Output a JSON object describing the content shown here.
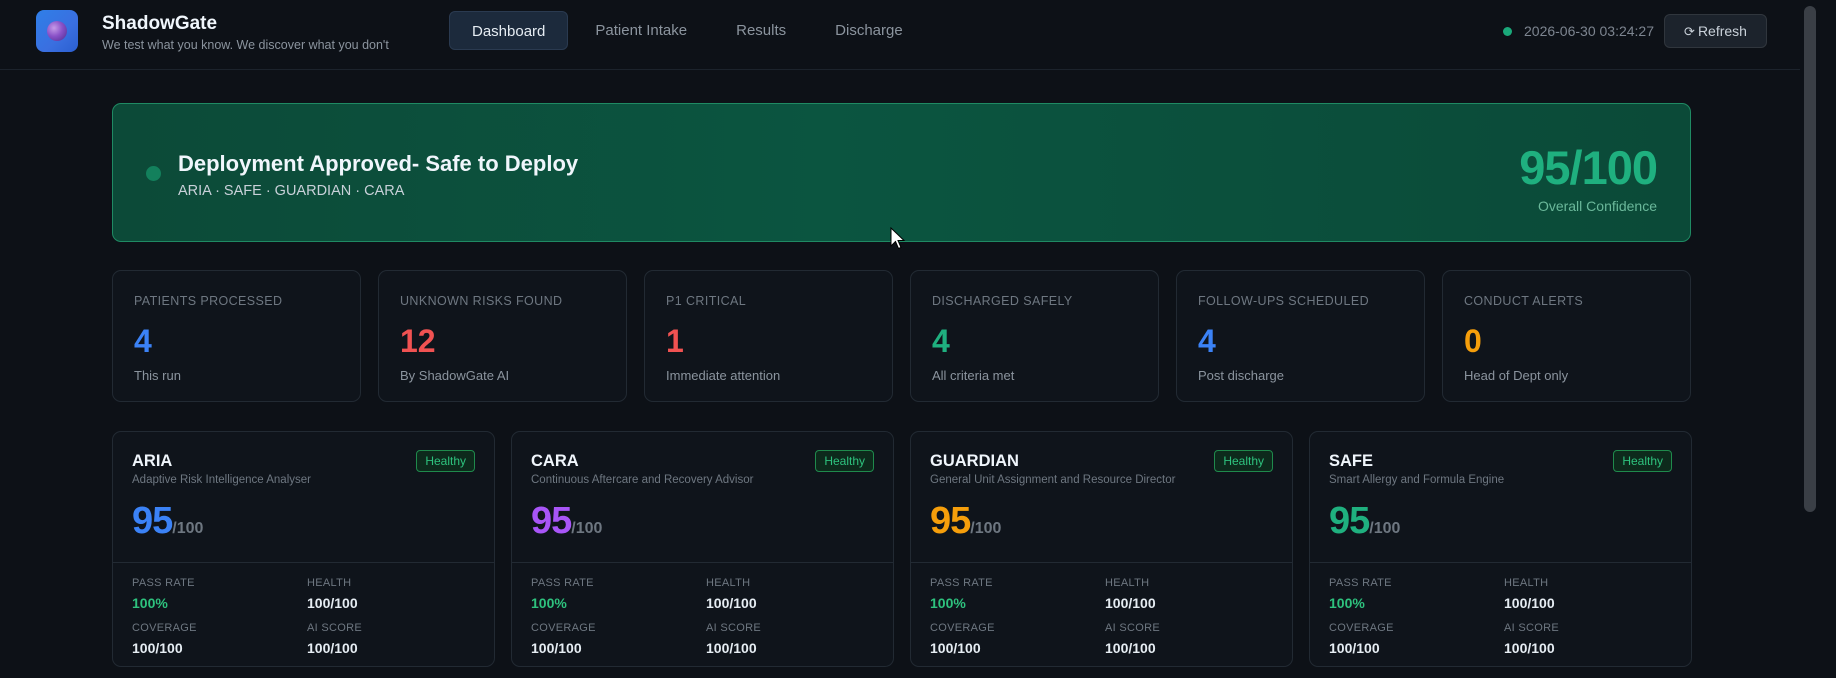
{
  "header": {
    "brand_name": "ShadowGate",
    "tagline": "We test what you know. We discover what you don't",
    "nav": [
      {
        "label": "Dashboard",
        "active": true
      },
      {
        "label": "Patient Intake",
        "active": false
      },
      {
        "label": "Results",
        "active": false
      },
      {
        "label": "Discharge",
        "active": false
      }
    ],
    "status_color": "#1aa87a",
    "timestamp": "2026-06-30 03:24:27",
    "refresh_icon": "refresh-icon",
    "refresh_label": "Refresh"
  },
  "banner": {
    "title": "Deployment Approved- Safe to Deploy",
    "subtitle": "ARIA · SAFE · GUARDIAN · CARA",
    "score": "95/100",
    "score_label": "Overall Confidence"
  },
  "stats": [
    {
      "label": "PATIENTS PROCESSED",
      "value": "4",
      "sub": "This run",
      "color": "#3b82f6"
    },
    {
      "label": "UNKNOWN RISKS FOUND",
      "value": "12",
      "sub": "By ShadowGate AI",
      "color": "#f05252"
    },
    {
      "label": "P1 CRITICAL",
      "value": "1",
      "sub": "Immediate attention",
      "color": "#f05252"
    },
    {
      "label": "DISCHARGED SAFELY",
      "value": "4",
      "sub": "All criteria met",
      "color": "#1fb07f"
    },
    {
      "label": "FOLLOW-UPS SCHEDULED",
      "value": "4",
      "sub": "Post discharge",
      "color": "#3b82f6"
    },
    {
      "label": "CONDUCT ALERTS",
      "value": "0",
      "sub": "Head of Dept only",
      "color": "#f59e0b"
    }
  ],
  "agents": [
    {
      "name": "ARIA",
      "description": "Adaptive Risk Intelligence Analyser",
      "badge": "Healthy",
      "score": "95",
      "out_of": "/100",
      "color": "#3b82f6",
      "metrics": {
        "pass_rate_label": "PASS RATE",
        "pass_rate": "100%",
        "health_label": "HEALTH",
        "health": "100/100",
        "coverage_label": "COVERAGE",
        "coverage": "100/100",
        "ai_score_label": "AI SCORE",
        "ai_score": "100/100"
      }
    },
    {
      "name": "CARA",
      "description": "Continuous Aftercare and Recovery Advisor",
      "badge": "Healthy",
      "score": "95",
      "out_of": "/100",
      "color": "#a855f7",
      "metrics": {
        "pass_rate_label": "PASS RATE",
        "pass_rate": "100%",
        "health_label": "HEALTH",
        "health": "100/100",
        "coverage_label": "COVERAGE",
        "coverage": "100/100",
        "ai_score_label": "AI SCORE",
        "ai_score": "100/100"
      }
    },
    {
      "name": "GUARDIAN",
      "description": "General Unit Assignment and Resource Director",
      "badge": "Healthy",
      "score": "95",
      "out_of": "/100",
      "color": "#f59e0b",
      "metrics": {
        "pass_rate_label": "PASS RATE",
        "pass_rate": "100%",
        "health_label": "HEALTH",
        "health": "100/100",
        "coverage_label": "COVERAGE",
        "coverage": "100/100",
        "ai_score_label": "AI SCORE",
        "ai_score": "100/100"
      }
    },
    {
      "name": "SAFE",
      "description": "Smart Allergy and Formula Engine",
      "badge": "Healthy",
      "score": "95",
      "out_of": "/100",
      "color": "#1fb07f",
      "metrics": {
        "pass_rate_label": "PASS RATE",
        "pass_rate": "100%",
        "health_label": "HEALTH",
        "health": "100/100",
        "coverage_label": "COVERAGE",
        "coverage": "100/100",
        "ai_score_label": "AI SCORE",
        "ai_score": "100/100"
      }
    }
  ]
}
